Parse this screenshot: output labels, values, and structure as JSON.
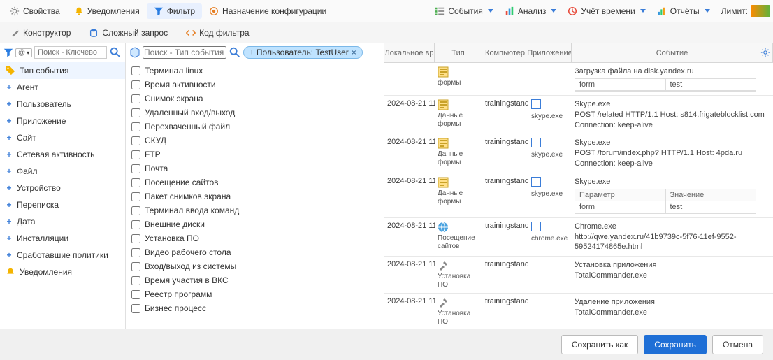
{
  "topbar": {
    "properties": "Свойства",
    "notifications": "Уведомления",
    "filter": "Фильтр",
    "config": "Назначение конфигурации",
    "events": "События",
    "analysis": "Анализ",
    "time_tracking": "Учёт времени",
    "reports": "Отчёты",
    "limit_label": "Лимит:"
  },
  "subtabs": {
    "constructor": "Конструктор",
    "complex": "Сложный запрос",
    "code": "Код фильтра"
  },
  "left": {
    "search_placeholder": "Поиск - Ключево",
    "categories": [
      {
        "label": "Тип события",
        "icon": "tag",
        "sel": true,
        "plus": false
      },
      {
        "label": "Агент"
      },
      {
        "label": "Пользователь"
      },
      {
        "label": "Приложение"
      },
      {
        "label": "Сайт"
      },
      {
        "label": "Сетевая активность"
      },
      {
        "label": "Файл"
      },
      {
        "label": "Устройство"
      },
      {
        "label": "Переписка"
      },
      {
        "label": "Дата"
      },
      {
        "label": "Инсталляции"
      },
      {
        "label": "Сработавшие политики"
      },
      {
        "label": "Уведомления",
        "icon": "bell",
        "plus": false
      }
    ]
  },
  "mid": {
    "search_placeholder": "Поиск - Тип события",
    "chip_label": "± Пользователь: TestUser",
    "items": [
      "Терминал linux",
      "Время активности",
      "Снимок экрана",
      "Удаленный вход/выход",
      "Перехваченный файл",
      "СКУД",
      "FTP",
      "Почта",
      "Посещение сайтов",
      "Пакет снимков экрана",
      "Терминал ввода команд",
      "Внешние диски",
      "Установка ПО",
      "Видео рабочего стола",
      "Вход/выход из системы",
      "Время участия в ВКС",
      "Реестр программ",
      "Бизнес процесс"
    ]
  },
  "grid": {
    "headers": {
      "time": "Локальное вр",
      "type": "Тип",
      "comp": "Компьютер",
      "app": "Приложение",
      "event": "Событие"
    },
    "rows": [
      {
        "time": "",
        "type_label": "формы",
        "type_icon": "form",
        "comp": "",
        "app_label": "",
        "app_icon": "",
        "event_lines": [
          "Загрузка файла на disk.yandex.ru"
        ],
        "mini": [
          [
            "form",
            "test"
          ]
        ],
        "mini_head": false
      },
      {
        "time": "2024-08-21 11",
        "type_label": "Данные формы",
        "type_icon": "form",
        "comp": "trainingstand",
        "app_label": "skype.exe",
        "app_icon": "win",
        "event_lines": [
          "Skype.exe",
          "POST /related HTTP/1.1 Host: s814.frigateblocklist.com",
          "Connection: keep-alive"
        ]
      },
      {
        "time": "2024-08-21 11",
        "type_label": "Данные формы",
        "type_icon": "form",
        "comp": "trainingstand",
        "app_label": "skype.exe",
        "app_icon": "win",
        "event_lines": [
          "Skype.exe",
          "POST /forum/index.php? HTTP/1.1 Host: 4pda.ru",
          "Connection: keep-alive"
        ]
      },
      {
        "time": "2024-08-21 11",
        "type_label": "Данные формы",
        "type_icon": "form",
        "comp": "trainingstand",
        "app_label": "skype.exe",
        "app_icon": "win",
        "event_lines": [
          "Skype.exe"
        ],
        "mini": [
          [
            "Параметр",
            "Значение"
          ],
          [
            "form",
            "test"
          ]
        ],
        "mini_head": true
      },
      {
        "time": "2024-08-21 11",
        "type_label": "Посещение сайтов",
        "type_icon": "globe",
        "comp": "trainingstand",
        "app_label": "chrome.exe",
        "app_icon": "win",
        "event_lines": [
          "Chrome.exe",
          "http://qwe.yandex.ru/41b9739c-5f76-11ef-9552-59524174865e.html"
        ]
      },
      {
        "time": "2024-08-21 11",
        "type_label": "Установка ПО",
        "type_icon": "tools",
        "comp": "trainingstand",
        "app_label": "",
        "app_icon": "",
        "event_lines": [
          "Установка приложения",
          "TotalCommander.exe"
        ]
      },
      {
        "time": "2024-08-21 11",
        "type_label": "Установка ПО",
        "type_icon": "tools",
        "comp": "trainingstand",
        "app_label": "",
        "app_icon": "",
        "event_lines": [
          "Удаление приложения",
          "TotalCommander.exe"
        ]
      }
    ]
  },
  "footer": {
    "save_as": "Сохранить как",
    "save": "Сохранить",
    "cancel": "Отмена"
  }
}
